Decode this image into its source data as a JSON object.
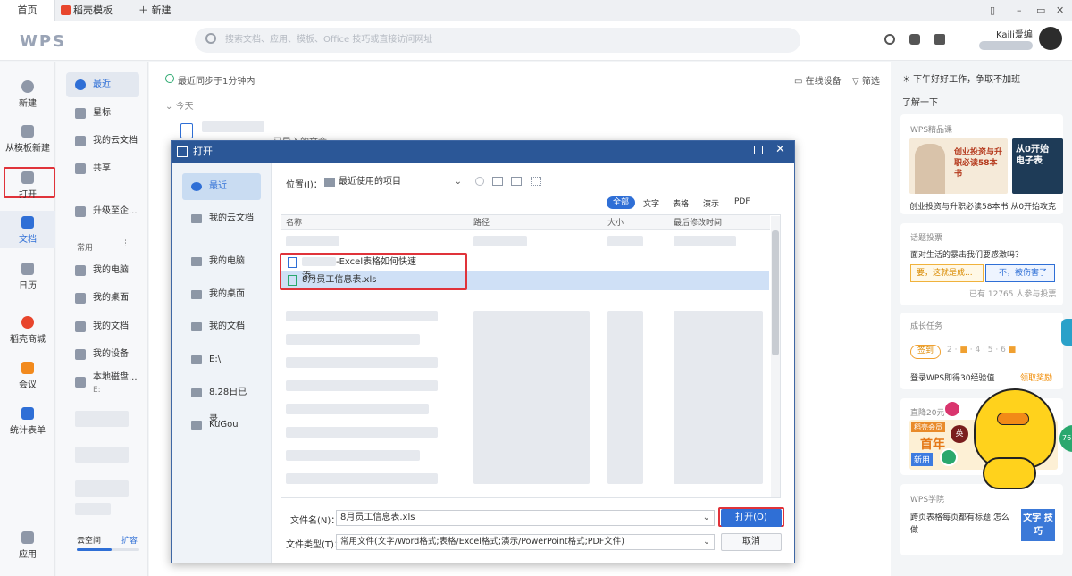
{
  "tabs": {
    "home": "首页",
    "template": "稻壳模板",
    "new": "新建"
  },
  "header": {
    "logo": "WPS",
    "search_placeholder": "搜索文档、应用、模板、Office 技巧或直接访问网址",
    "username": "Kaili爱编"
  },
  "leftbar": {
    "new": "新建",
    "from_template": "从模板新建",
    "open": "打开",
    "docs": "文档",
    "calendar": "日历",
    "store": "稻壳商城",
    "meeting": "会议",
    "forms": "统计表单",
    "apps": "应用"
  },
  "nav": {
    "recent": "最近",
    "star": "星标",
    "cloud": "我的云文档",
    "share": "共享",
    "upgrade": "升级至企...",
    "common": "常用",
    "my_pc": "我的电脑",
    "my_desktop": "我的桌面",
    "my_docs": "我的文档",
    "my_devices": "我的设备",
    "local_disk": "本地磁盘...",
    "local_disk_sub": "E:",
    "cloud_space": "云空间",
    "expand": "扩容"
  },
  "main": {
    "sync": "最近同步于1分钟内",
    "online_devices": "在线设备",
    "filter": "筛选",
    "today": "今天",
    "hint": "已导入的文章"
  },
  "dialog": {
    "title": "打开",
    "location_label": "位置(I)：",
    "location_value": "最近使用的项目",
    "filters": [
      "全部",
      "文字",
      "表格",
      "演示",
      "PDF"
    ],
    "sidebar": [
      "最近",
      "我的云文档",
      "我的电脑",
      "我的桌面",
      "我的文档",
      "E:\\",
      "8.28日已录...",
      "KuGou"
    ],
    "columns": [
      "名称",
      "路径",
      "大小",
      "最后修改时间"
    ],
    "files": [
      "-Excel表格如何快速添...",
      "8月员工信息表.xls"
    ],
    "filename_label": "文件名(N)：",
    "filename_value": "8月员工信息表.xls",
    "filetype_label": "文件类型(T)：",
    "filetype_value": "常用文件(文字/Word格式;表格/Excel格式;演示/PowerPoint格式;PDF文件)",
    "open_button": "打开(O)",
    "cancel_button": "取消"
  },
  "right": {
    "greeting": "下午好好工作，争取不加班",
    "learn": "了解一下",
    "course_title": "WPS精品课",
    "course_img1": "创业投资与升职必读58本书",
    "course_img2": "从0开始 电子表",
    "course_caption1": "创业投资与升职必读58本书",
    "course_caption2": "从0开始攻克",
    "vote_title": "话题投票",
    "vote_q": "面对生活的暴击我们要感激吗？",
    "vote_a": "要，这就是成...",
    "vote_b": "不，被伤害了",
    "vote_count": "已有 12765 人参与投票",
    "task_title": "成长任务",
    "task_checkin": "签到",
    "task_steps": [
      "2",
      "4",
      "5",
      "6"
    ],
    "task_text": "登录WPS即得30经验值",
    "task_reward": "领取奖励",
    "member_title": "直降20元",
    "member_badge": "稻壳会员",
    "member_text": "首年",
    "member_sub": "新用",
    "academy_title": "WPS学院",
    "academy_text": "跨页表格每页都有标题 怎么做",
    "academy_img": "文字 技巧",
    "badge_ying": "英",
    "side_number": "76"
  },
  "colors": {
    "accent": "#2f6fd6",
    "red": "#e0333a",
    "dialog_title": "#2b5797"
  }
}
